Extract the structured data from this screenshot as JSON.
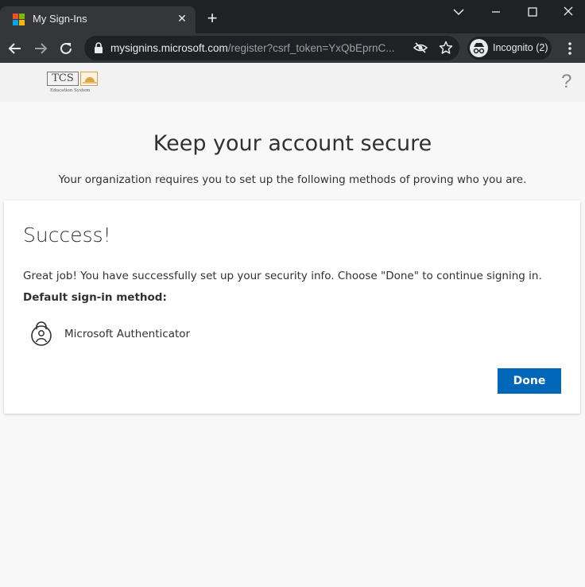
{
  "browser": {
    "tab_title": "My Sign-Ins",
    "tab_close": "✕",
    "new_tab": "+",
    "url_host": "mysignins.microsoft.com",
    "url_path": "/register?csrf_token=YxQbEprnC...",
    "incognito_label": "Incognito (2)"
  },
  "page": {
    "logo_text": "TCS",
    "logo_subtext": "Education System",
    "help": "?",
    "heading": "Keep your account secure",
    "subheading": "Your organization requires you to set up the following methods of proving who you are."
  },
  "card": {
    "title": "Success!",
    "message": "Great job! You have successfully set up your security info. Choose \"Done\" to continue signing in.",
    "default_label": "Default sign-in method:",
    "method_name": "Microsoft Authenticator",
    "method_icon": "authenticator-lock-icon",
    "done_label": "Done"
  },
  "colors": {
    "accent": "#0067b8",
    "chrome_dark": "#202124",
    "chrome_toolbar": "#35363a"
  }
}
